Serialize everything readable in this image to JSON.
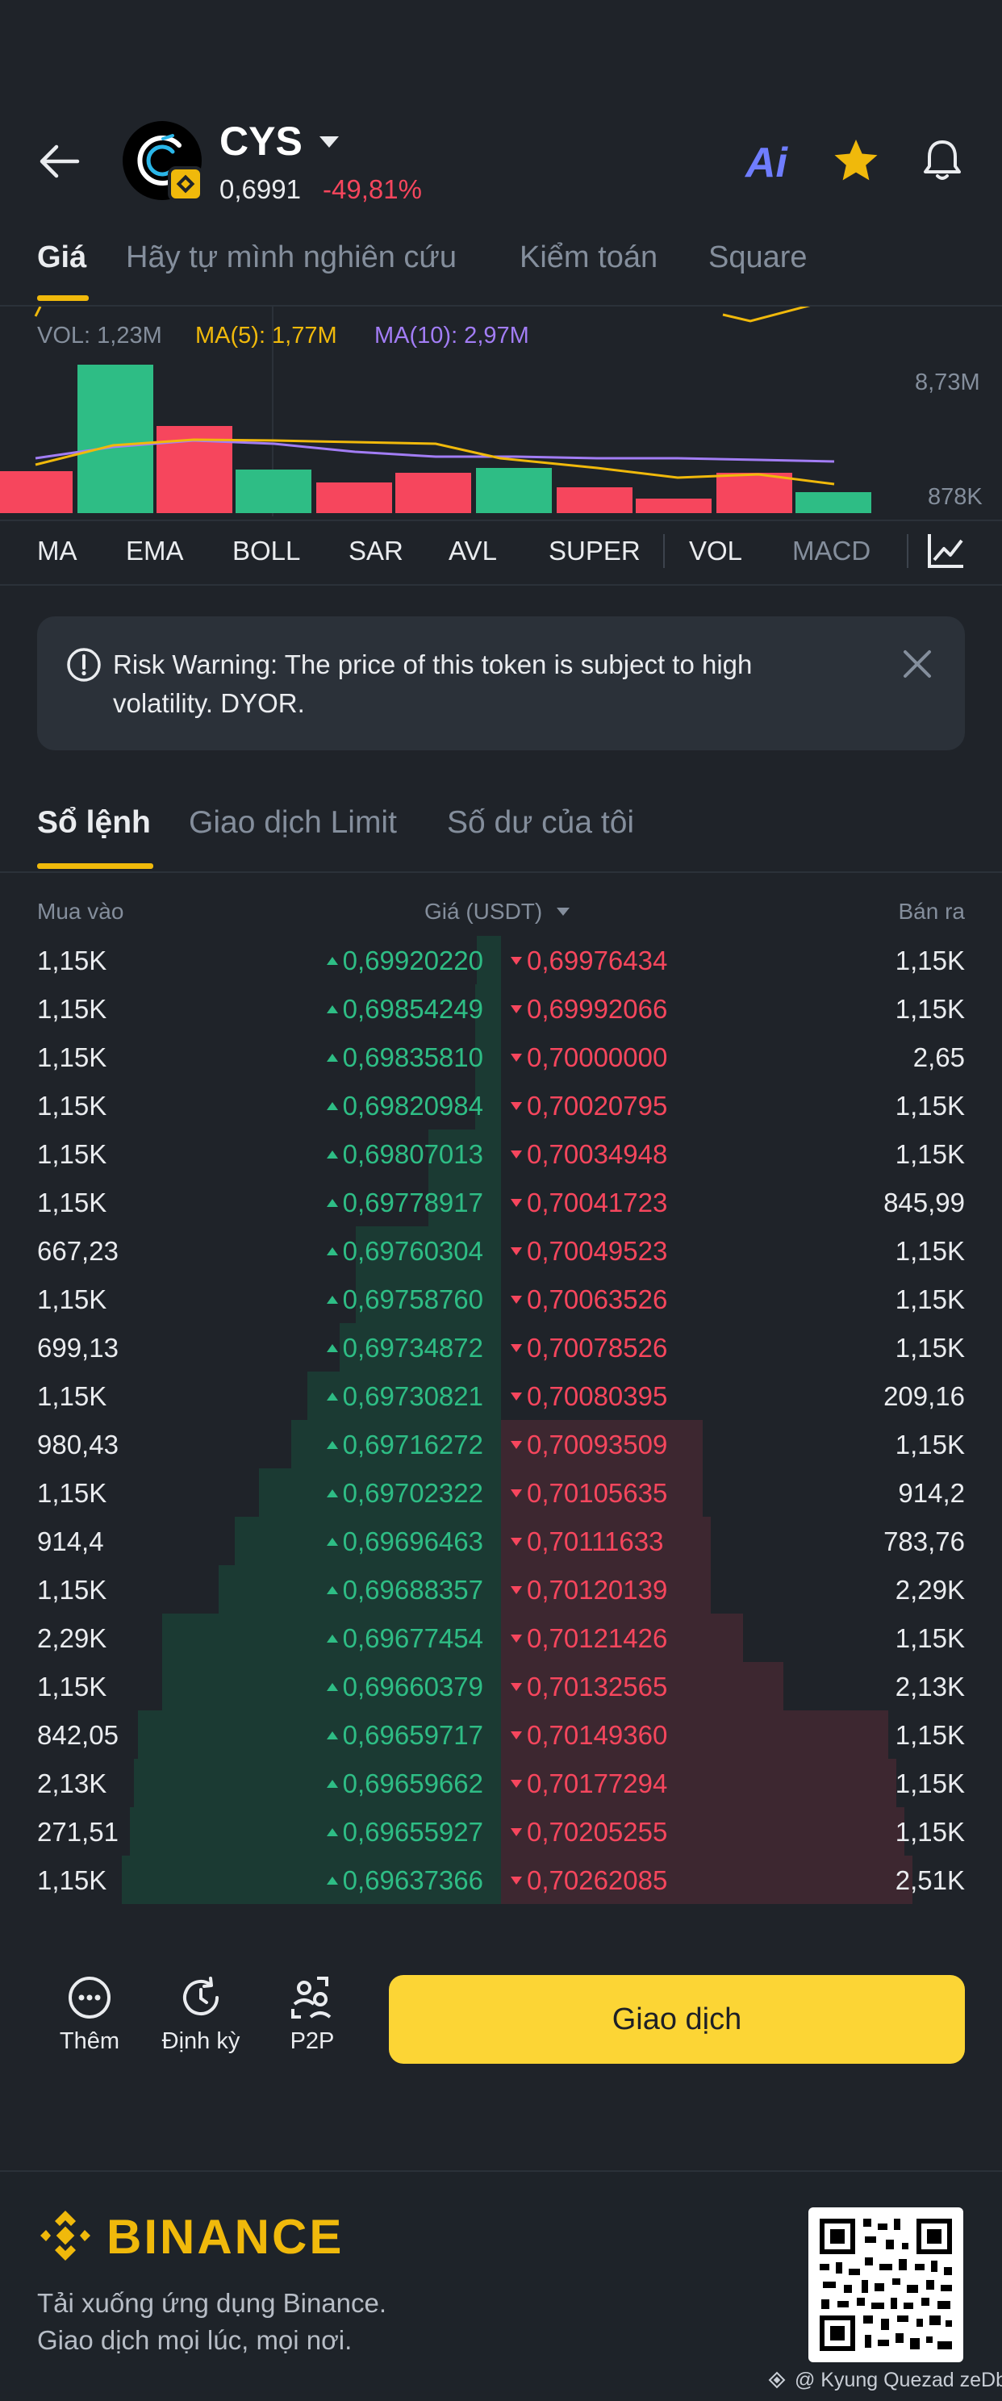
{
  "header": {
    "symbol": "CYS",
    "price": "0,6991",
    "change": "-49,81%",
    "ai_label": "Ai"
  },
  "top_tabs": [
    "Giá",
    "Hãy tự mình nghiên cứu",
    "Kiểm toán",
    "Square"
  ],
  "chart": {
    "vol_label": "VOL: 1,23M",
    "ma5_label": "MA(5): 1,77M",
    "ma10_label": "MA(10): 2,97M",
    "axis_top": "8,73M",
    "axis_bottom": "878K",
    "colors": {
      "up": "#2ebd85",
      "down": "#f6465d",
      "ma5": "#f0b90b",
      "ma10": "#a27df5"
    }
  },
  "indicators": [
    "MA",
    "EMA",
    "BOLL",
    "SAR",
    "AVL",
    "SUPER",
    "VOL",
    "MACD"
  ],
  "risk": {
    "text": "Risk Warning: The price of this token is subject to high volatility. DYOR."
  },
  "order_tabs": [
    "Sổ lệnh",
    "Giao dịch Limit",
    "Số dư của tôi"
  ],
  "order_book": {
    "headers": {
      "bid": "Mua vào",
      "price": "Giá (USDT)",
      "ask": "Bán ra"
    },
    "rows": [
      {
        "bid_qty": "1,15K",
        "bid_price": "0,69920220",
        "ask_price": "0,69976434",
        "ask_qty": "1,15K"
      },
      {
        "bid_qty": "1,15K",
        "bid_price": "0,69854249",
        "ask_price": "0,69992066",
        "ask_qty": "1,15K"
      },
      {
        "bid_qty": "1,15K",
        "bid_price": "0,69835810",
        "ask_price": "0,70000000",
        "ask_qty": "2,65"
      },
      {
        "bid_qty": "1,15K",
        "bid_price": "0,69820984",
        "ask_price": "0,70020795",
        "ask_qty": "1,15K"
      },
      {
        "bid_qty": "1,15K",
        "bid_price": "0,69807013",
        "ask_price": "0,70034948",
        "ask_qty": "1,15K"
      },
      {
        "bid_qty": "1,15K",
        "bid_price": "0,69778917",
        "ask_price": "0,70041723",
        "ask_qty": "845,99"
      },
      {
        "bid_qty": "667,23",
        "bid_price": "0,69760304",
        "ask_price": "0,70049523",
        "ask_qty": "1,15K"
      },
      {
        "bid_qty": "1,15K",
        "bid_price": "0,69758760",
        "ask_price": "0,70063526",
        "ask_qty": "1,15K"
      },
      {
        "bid_qty": "699,13",
        "bid_price": "0,69734872",
        "ask_price": "0,70078526",
        "ask_qty": "1,15K"
      },
      {
        "bid_qty": "1,15K",
        "bid_price": "0,69730821",
        "ask_price": "0,70080395",
        "ask_qty": "209,16"
      },
      {
        "bid_qty": "980,43",
        "bid_price": "0,69716272",
        "ask_price": "0,70093509",
        "ask_qty": "1,15K"
      },
      {
        "bid_qty": "1,15K",
        "bid_price": "0,69702322",
        "ask_price": "0,70105635",
        "ask_qty": "914,2"
      },
      {
        "bid_qty": "914,4",
        "bid_price": "0,69696463",
        "ask_price": "0,70111633",
        "ask_qty": "783,76"
      },
      {
        "bid_qty": "1,15K",
        "bid_price": "0,69688357",
        "ask_price": "0,70120139",
        "ask_qty": "2,29K"
      },
      {
        "bid_qty": "2,29K",
        "bid_price": "0,69677454",
        "ask_price": "0,70121426",
        "ask_qty": "1,15K"
      },
      {
        "bid_qty": "1,15K",
        "bid_price": "0,69660379",
        "ask_price": "0,70132565",
        "ask_qty": "2,13K"
      },
      {
        "bid_qty": "842,05",
        "bid_price": "0,69659717",
        "ask_price": "0,70149360",
        "ask_qty": "1,15K"
      },
      {
        "bid_qty": "2,13K",
        "bid_price": "0,69659662",
        "ask_price": "0,70177294",
        "ask_qty": "1,15K"
      },
      {
        "bid_qty": "271,51",
        "bid_price": "0,69655927",
        "ask_price": "0,70205255",
        "ask_qty": "1,15K"
      },
      {
        "bid_qty": "1,15K",
        "bid_price": "0,69637366",
        "ask_price": "0,70262085",
        "ask_qty": "2,51K"
      }
    ]
  },
  "actions": {
    "more": "Thêm",
    "recurring": "Định kỳ",
    "p2p": "P2P",
    "trade": "Giao dịch"
  },
  "footer": {
    "brand": "BINANCE",
    "line1": "Tải xuống ứng dụng Binance.",
    "line2": "Giao dịch mọi lúc, mọi nơi.",
    "credit": "@ Kyung Quezad zeDb"
  }
}
